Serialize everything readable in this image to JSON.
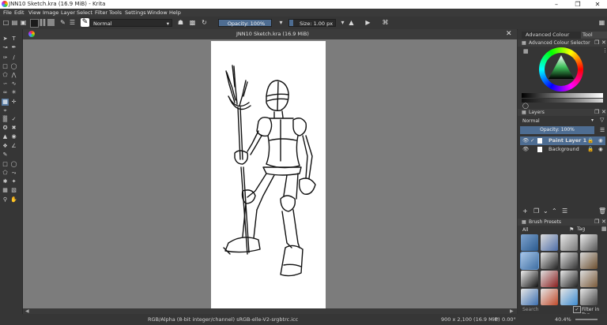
{
  "window": {
    "title": "JNN10 Sketch.kra (16.9 MiB) - Krita"
  },
  "menu": [
    "File",
    "Edit",
    "View",
    "Image",
    "Layer",
    "Select",
    "Filter",
    "Tools",
    "Settings",
    "Window",
    "Help"
  ],
  "toolbar": {
    "blend_mode": "Normal",
    "opacity": "Opacity: 100%",
    "size": "Size: 1.00 px"
  },
  "document": {
    "tab_title": "JNN10 Sketch.kra (16.9 MiB)"
  },
  "dock": {
    "color_tabs": [
      "Advanced Colour Sele...",
      "Tool Opt..."
    ],
    "color_title": "Advanced Colour Selector",
    "layers_title": "Layers",
    "layers_blend": "Normal",
    "layers_opacity": "Opacity:  100%",
    "layers": [
      {
        "name": "Paint Layer 1",
        "selected": true
      },
      {
        "name": "Background",
        "selected": false
      }
    ],
    "brushes_title": "Brush Presets",
    "brushes_filter": "All",
    "brushes_tag": "Tag",
    "search_placeholder": "Search",
    "filter_in_tag": "Filter in Tag"
  },
  "status": {
    "color_space": "RGB/Alpha (8-bit integer/channel)  sRGB-elle-V2-srgbtrc.icc",
    "dimensions": "900 x 2,100 (16.9 MiB)",
    "zoom": "40.4%",
    "rotation": "0.00°"
  },
  "colors": {
    "accent": "#5a7ca3",
    "canvas_bg": "#7c7c7c",
    "ui_bg": "#363636"
  }
}
